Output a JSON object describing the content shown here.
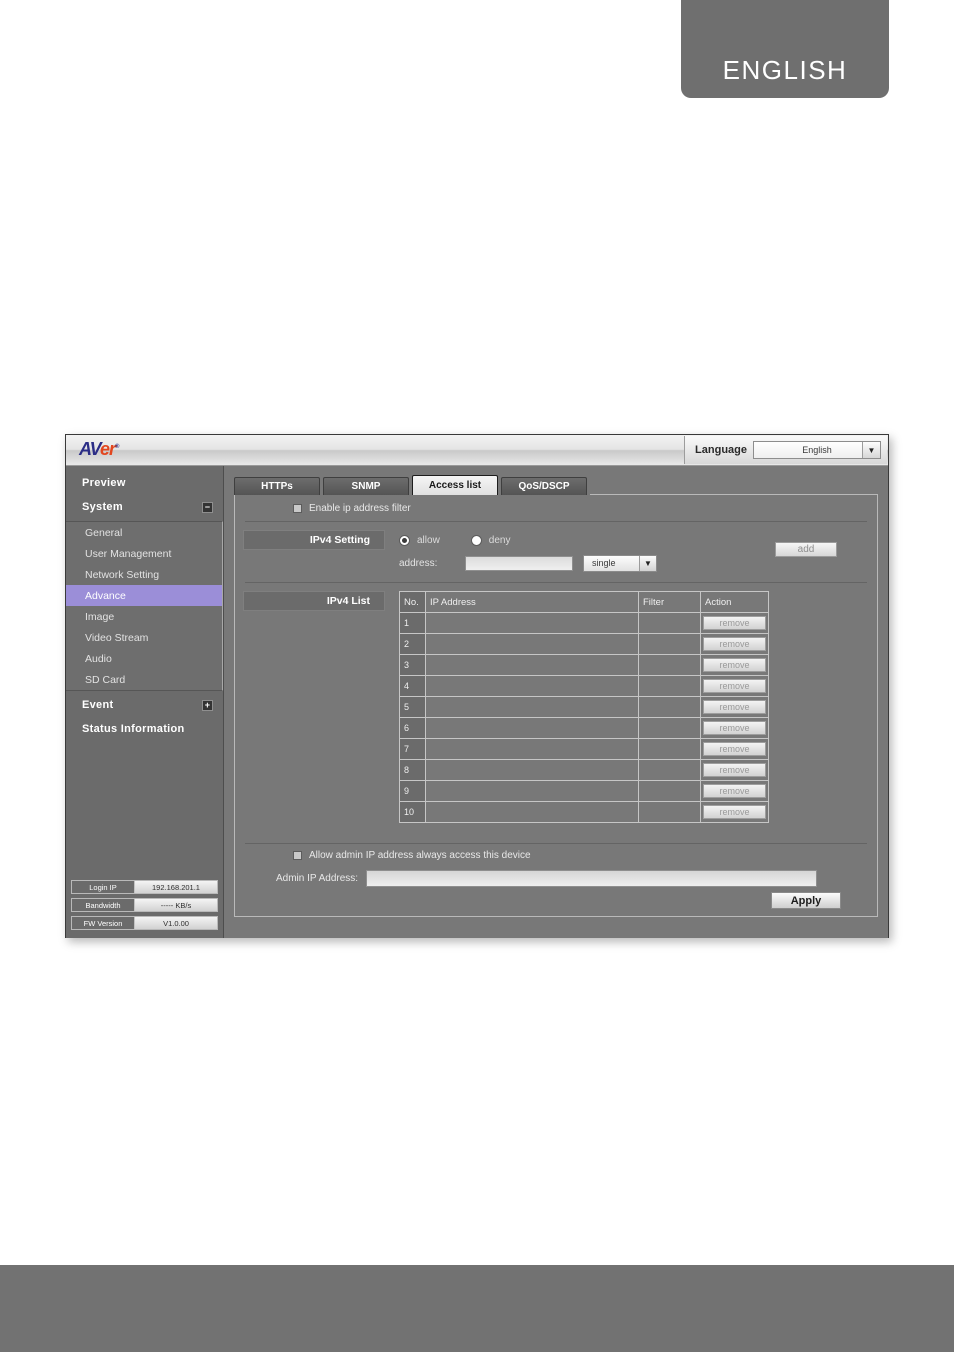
{
  "page": {
    "language_banner": "ENGLISH"
  },
  "app": {
    "logo": {
      "part1": "AV",
      "part2": "er",
      "trademark": "®"
    },
    "language": {
      "label": "Language",
      "selected": "English",
      "arrow": "▼"
    }
  },
  "sidebar": {
    "main_items": [
      {
        "label": "Preview",
        "toggle": ""
      },
      {
        "label": "System",
        "toggle": "−"
      }
    ],
    "sub_items": [
      {
        "label": "General",
        "active": false
      },
      {
        "label": "User Management",
        "active": false
      },
      {
        "label": "Network Setting",
        "active": false
      },
      {
        "label": "Advance",
        "active": true
      },
      {
        "label": "Image",
        "active": false
      },
      {
        "label": "Video Stream",
        "active": false
      },
      {
        "label": "Audio",
        "active": false
      },
      {
        "label": "SD Card",
        "active": false
      }
    ],
    "tail_items": [
      {
        "label": "Event",
        "toggle": "+"
      },
      {
        "label": "Status Information",
        "toggle": ""
      }
    ],
    "status": [
      {
        "key": "Login IP",
        "value": "192.168.201.1"
      },
      {
        "key": "Bandwidth",
        "value": "----- KB/s"
      },
      {
        "key": "FW Version",
        "value": "V1.0.00"
      }
    ]
  },
  "tabs": [
    {
      "label": "HTTPs",
      "active": false
    },
    {
      "label": "SNMP",
      "active": false
    },
    {
      "label": "Access list",
      "active": true
    },
    {
      "label": "QoS/DSCP",
      "active": false
    }
  ],
  "main": {
    "enable_filter_label": "Enable ip address filter",
    "ipv4_setting": {
      "title": "IPv4 Setting",
      "allow_label": "allow",
      "deny_label": "deny",
      "address_label": "address:",
      "address_value": "",
      "address_placeholder": "",
      "mode_selected": "single",
      "mode_arrow": "▼",
      "add_label": "add"
    },
    "ipv4_list": {
      "title": "IPv4 List",
      "columns": [
        "No.",
        "IP Address",
        "Filter",
        "Action"
      ],
      "rows": [
        {
          "no": "1",
          "ip": "",
          "filter": "",
          "action": "remove"
        },
        {
          "no": "2",
          "ip": "",
          "filter": "",
          "action": "remove"
        },
        {
          "no": "3",
          "ip": "",
          "filter": "",
          "action": "remove"
        },
        {
          "no": "4",
          "ip": "",
          "filter": "",
          "action": "remove"
        },
        {
          "no": "5",
          "ip": "",
          "filter": "",
          "action": "remove"
        },
        {
          "no": "6",
          "ip": "",
          "filter": "",
          "action": "remove"
        },
        {
          "no": "7",
          "ip": "",
          "filter": "",
          "action": "remove"
        },
        {
          "no": "8",
          "ip": "",
          "filter": "",
          "action": "remove"
        },
        {
          "no": "9",
          "ip": "",
          "filter": "",
          "action": "remove"
        },
        {
          "no": "10",
          "ip": "",
          "filter": "",
          "action": "remove"
        }
      ]
    },
    "admin": {
      "allow_label": "Allow admin IP address always access this device",
      "ip_label": "Admin IP Address:",
      "ip_value": "",
      "apply_label": "Apply"
    }
  },
  "colors": {
    "accent_highlight": "#9b8ed8",
    "window_bg": "#787878",
    "sidebar_bg": "#6b6b6b",
    "banner_gray": "#6f6f6f"
  }
}
